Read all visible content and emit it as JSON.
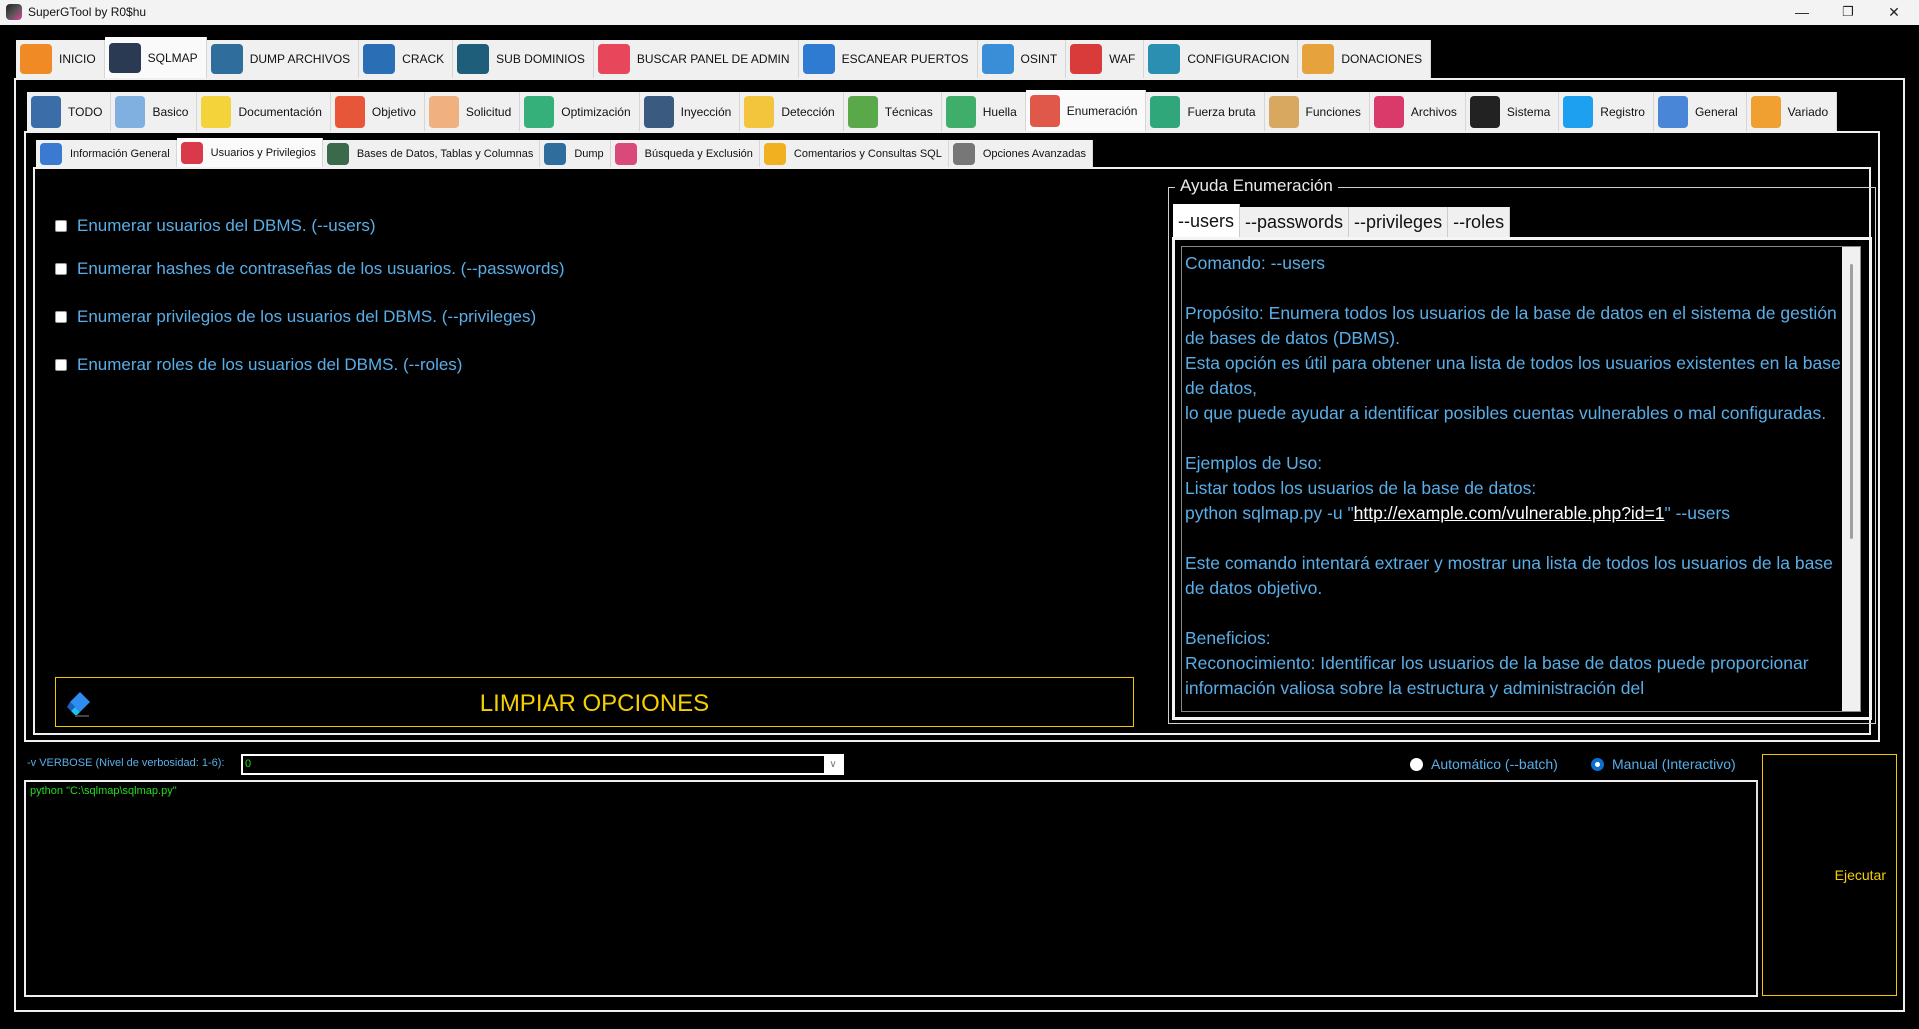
{
  "window": {
    "title": "SuperGTool by R0$hu",
    "controls": {
      "minimize": "—",
      "maximize": "❐",
      "close": "✕"
    }
  },
  "top_tabs": [
    {
      "label": "INICIO",
      "icon": "home-icon",
      "color": "#f08a24",
      "active": false
    },
    {
      "label": "SQLMAP",
      "icon": "terminal-icon",
      "color": "#2a3a52",
      "active": true
    },
    {
      "label": "DUMP ARCHIVOS",
      "icon": "database-download-icon",
      "color": "#2f6e9c",
      "active": false
    },
    {
      "label": "CRACK",
      "icon": "password-lock-icon",
      "color": "#2a6fb5",
      "active": false
    },
    {
      "label": "SUB DOMINIOS",
      "icon": "network-globe-icon",
      "color": "#1f5e7a",
      "active": false
    },
    {
      "label": "BUSCAR PANEL DE ADMIN",
      "icon": "admin-panel-icon",
      "color": "#e8465a",
      "active": false
    },
    {
      "label": "ESCANEAR PUERTOS",
      "icon": "port-scan-icon",
      "color": "#2f7bd1",
      "active": false
    },
    {
      "label": "OSINT",
      "icon": "open-lock-icon",
      "color": "#3a8ed8",
      "active": false
    },
    {
      "label": "WAF",
      "icon": "firewall-icon",
      "color": "#d93a3a",
      "active": false
    },
    {
      "label": "CONFIGURACION",
      "icon": "gear-icon",
      "color": "#2a8fb0",
      "active": false
    },
    {
      "label": "DONACIONES",
      "icon": "donate-box-icon",
      "color": "#e6a23c",
      "active": false
    }
  ],
  "sub_tabs": [
    {
      "label": "TODO",
      "icon": "hacker-icon",
      "color": "#3b6ea8",
      "active": false
    },
    {
      "label": "Basico",
      "icon": "robot-icon",
      "color": "#7fb0e0",
      "active": false
    },
    {
      "label": "Documentación",
      "icon": "sql-document-icon",
      "color": "#f3d23a",
      "active": false
    },
    {
      "label": "Objetivo",
      "icon": "target-icon",
      "color": "#e8563a",
      "active": false
    },
    {
      "label": "Solicitud",
      "icon": "request-form-icon",
      "color": "#f0b080",
      "active": false
    },
    {
      "label": "Optimización",
      "icon": "speed-gauge-icon",
      "color": "#35b07a",
      "active": false
    },
    {
      "label": "Inyección",
      "icon": "database-syringe-icon",
      "color": "#3a5a80",
      "active": false
    },
    {
      "label": "Detección",
      "icon": "warning-magnifier-icon",
      "color": "#f2c53d",
      "active": false
    },
    {
      "label": "Técnicas",
      "icon": "lightbulb-gear-icon",
      "color": "#5aa84a",
      "active": false
    },
    {
      "label": "Huella",
      "icon": "fingerprint-icon",
      "color": "#3fae6a",
      "active": false
    },
    {
      "label": "Enumeración",
      "icon": "server-person-icon",
      "color": "#e0584a",
      "active": true
    },
    {
      "label": "Fuerza bruta",
      "icon": "binary-chat-icon",
      "color": "#2fa77a",
      "active": false
    },
    {
      "label": "Funciones",
      "icon": "head-gear-icon",
      "color": "#d9a860",
      "active": false
    },
    {
      "label": "Archivos",
      "icon": "root-file-icon",
      "color": "#d93a6a",
      "active": false
    },
    {
      "label": "Sistema",
      "icon": "linux-penguin-icon",
      "color": "#222222",
      "active": false
    },
    {
      "label": "Registro",
      "icon": "windows-icon",
      "color": "#1ea0f0",
      "active": false
    },
    {
      "label": "General",
      "icon": "globe-cycle-icon",
      "color": "#4a86d8",
      "active": false
    },
    {
      "label": "Variado",
      "icon": "toolbox-icon",
      "color": "#f0a030",
      "active": false
    }
  ],
  "enum_tabs": [
    {
      "label": "Información General",
      "icon": "info-search-icon",
      "color": "#3a7ad0",
      "active": false
    },
    {
      "label": "Usuarios y Privilegios",
      "icon": "user-vip-icon",
      "color": "#d93a4a",
      "active": true
    },
    {
      "label": "Bases de Datos, Tablas y Columnas",
      "icon": "db-tables-icon",
      "color": "#3a6a4a",
      "active": false
    },
    {
      "label": "Dump",
      "icon": "database-download-icon",
      "color": "#2f6e9c",
      "active": false
    },
    {
      "label": "Búsqueda y Exclusión",
      "icon": "search-exclude-icon",
      "color": "#d94a7a",
      "active": false
    },
    {
      "label": "Comentarios y Consultas SQL",
      "icon": "sql-cylinder-icon",
      "color": "#f0b020",
      "active": false
    },
    {
      "label": "Opciones Avanzadas",
      "icon": "advanced-chip-icon",
      "color": "#777777",
      "active": false
    }
  ],
  "options": [
    {
      "label": "Enumerar usuarios del DBMS. (--users)",
      "checked": false
    },
    {
      "label": "Enumerar hashes de contraseñas de los usuarios. (--passwords)",
      "checked": false
    },
    {
      "label": "Enumerar privilegios de los usuarios del DBMS. (--privileges)",
      "checked": false
    },
    {
      "label": "Enumerar roles de los usuarios del DBMS. (--roles)",
      "checked": false
    }
  ],
  "help": {
    "title": "Ayuda Enumeración",
    "tabs": [
      {
        "label": "--users",
        "active": true
      },
      {
        "label": "--passwords",
        "active": false
      },
      {
        "label": "--privileges",
        "active": false
      },
      {
        "label": "--roles",
        "active": false
      }
    ],
    "text_before_link": "Comando: --users\n\nPropósito: Enumera todos los usuarios de la base de datos en el sistema de gestión de bases de datos (DBMS).\nEsta opción es útil para obtener una lista de todos los usuarios existentes en la base de datos,\nlo que puede ayudar a identificar posibles cuentas vulnerables o mal configuradas.\n\nEjemplos de Uso:\nListar todos los usuarios de la base de datos:\npython sqlmap.py -u \"",
    "link": "http://example.com/vulnerable.php?id=1",
    "text_after_link": "\" --users\n\nEste comando intentará extraer y mostrar una lista de todos los usuarios de la base de datos objetivo.\n\nBeneficios:\nReconocimiento: Identificar los usuarios de la base de datos puede proporcionar información valiosa sobre la estructura y administración del"
  },
  "clear_button": {
    "label": "LIMPIAR OPCIONES",
    "icon": "eraser-icon"
  },
  "verbose": {
    "label": "-v VERBOSE (Nivel de verbosidad: 1-6):",
    "value": "0"
  },
  "mode": {
    "options": [
      {
        "label": "Automático (--batch)",
        "selected": false
      },
      {
        "label": "Manual (Interactivo)",
        "selected": true
      }
    ]
  },
  "console": {
    "command": "python \"C:\\sqlmap\\sqlmap.py\""
  },
  "run_button": {
    "label": "Ejecutar"
  },
  "colors": {
    "text_blue": "#5aaee8",
    "accent_yellow": "#f5d000",
    "console_green": "#22dd22",
    "background": "#000000"
  }
}
